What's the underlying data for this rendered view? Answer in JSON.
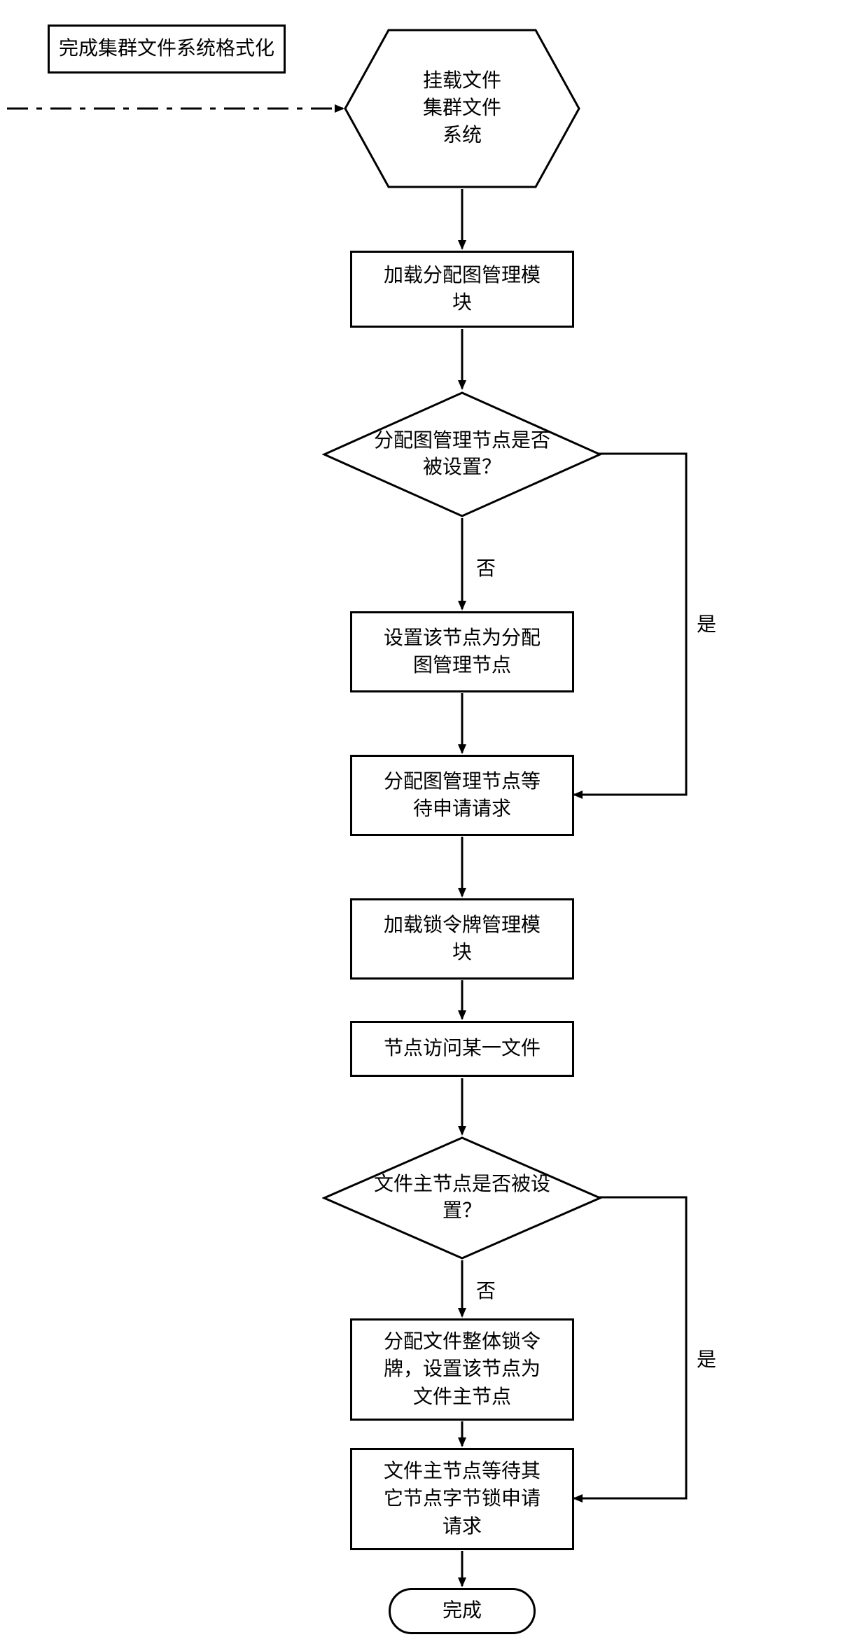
{
  "nodes": {
    "ext": "完成集群文件系统格式化",
    "start": "挂载文件\n集群文件\n系统",
    "b1": "加载分配图管理模\n块",
    "d1": "分配图管理节点是否\n被设置？",
    "b2": "设置该节点为分配\n图管理节点",
    "b3": "分配图管理节点等\n待申请请求",
    "b4": "加载锁令牌管理模\n块",
    "b5": "节点访问某一文件",
    "d2": "文件主节点是否被设\n置？",
    "b6": "分配文件整体锁令\n牌，设置该节点为\n文件主节点",
    "b7": "文件主节点等待其\n它节点字节锁申请\n请求",
    "end": "完成"
  },
  "labels": {
    "yes": "是",
    "no": "否"
  }
}
